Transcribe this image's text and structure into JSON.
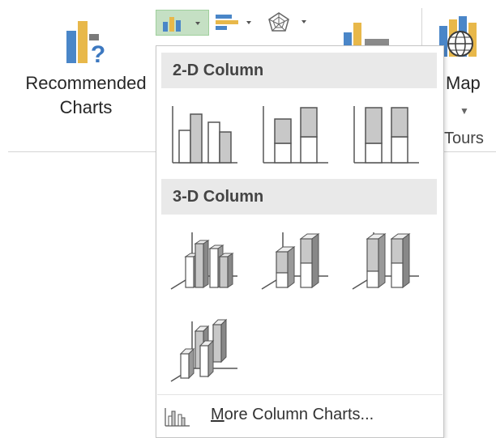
{
  "ribbon": {
    "recommended_charts": {
      "line1": "Recommended",
      "line2": "Charts"
    },
    "map": {
      "label": "Map"
    },
    "tours": {
      "label": "Tours"
    }
  },
  "dropdown": {
    "section_2d": {
      "title": "2-D Column"
    },
    "section_3d": {
      "title": "3-D Column"
    },
    "more": {
      "first_letter": "M",
      "rest": "ore Column Charts..."
    }
  },
  "colors": {
    "selected_button_bg": "#c5e0c4",
    "section_header_bg": "#e9e9e9",
    "chart_fill_gray": "#c8c8c8",
    "ribbon_blue": "#4a86c8",
    "ribbon_yellow": "#e8b84a",
    "ribbon_green": "#5ba14d"
  },
  "icons": {
    "recommended": "recommended-charts-icon",
    "column": "column-chart-icon",
    "bar": "bar-chart-icon",
    "radar": "radar-chart-icon",
    "map": "3d-map-icon"
  }
}
